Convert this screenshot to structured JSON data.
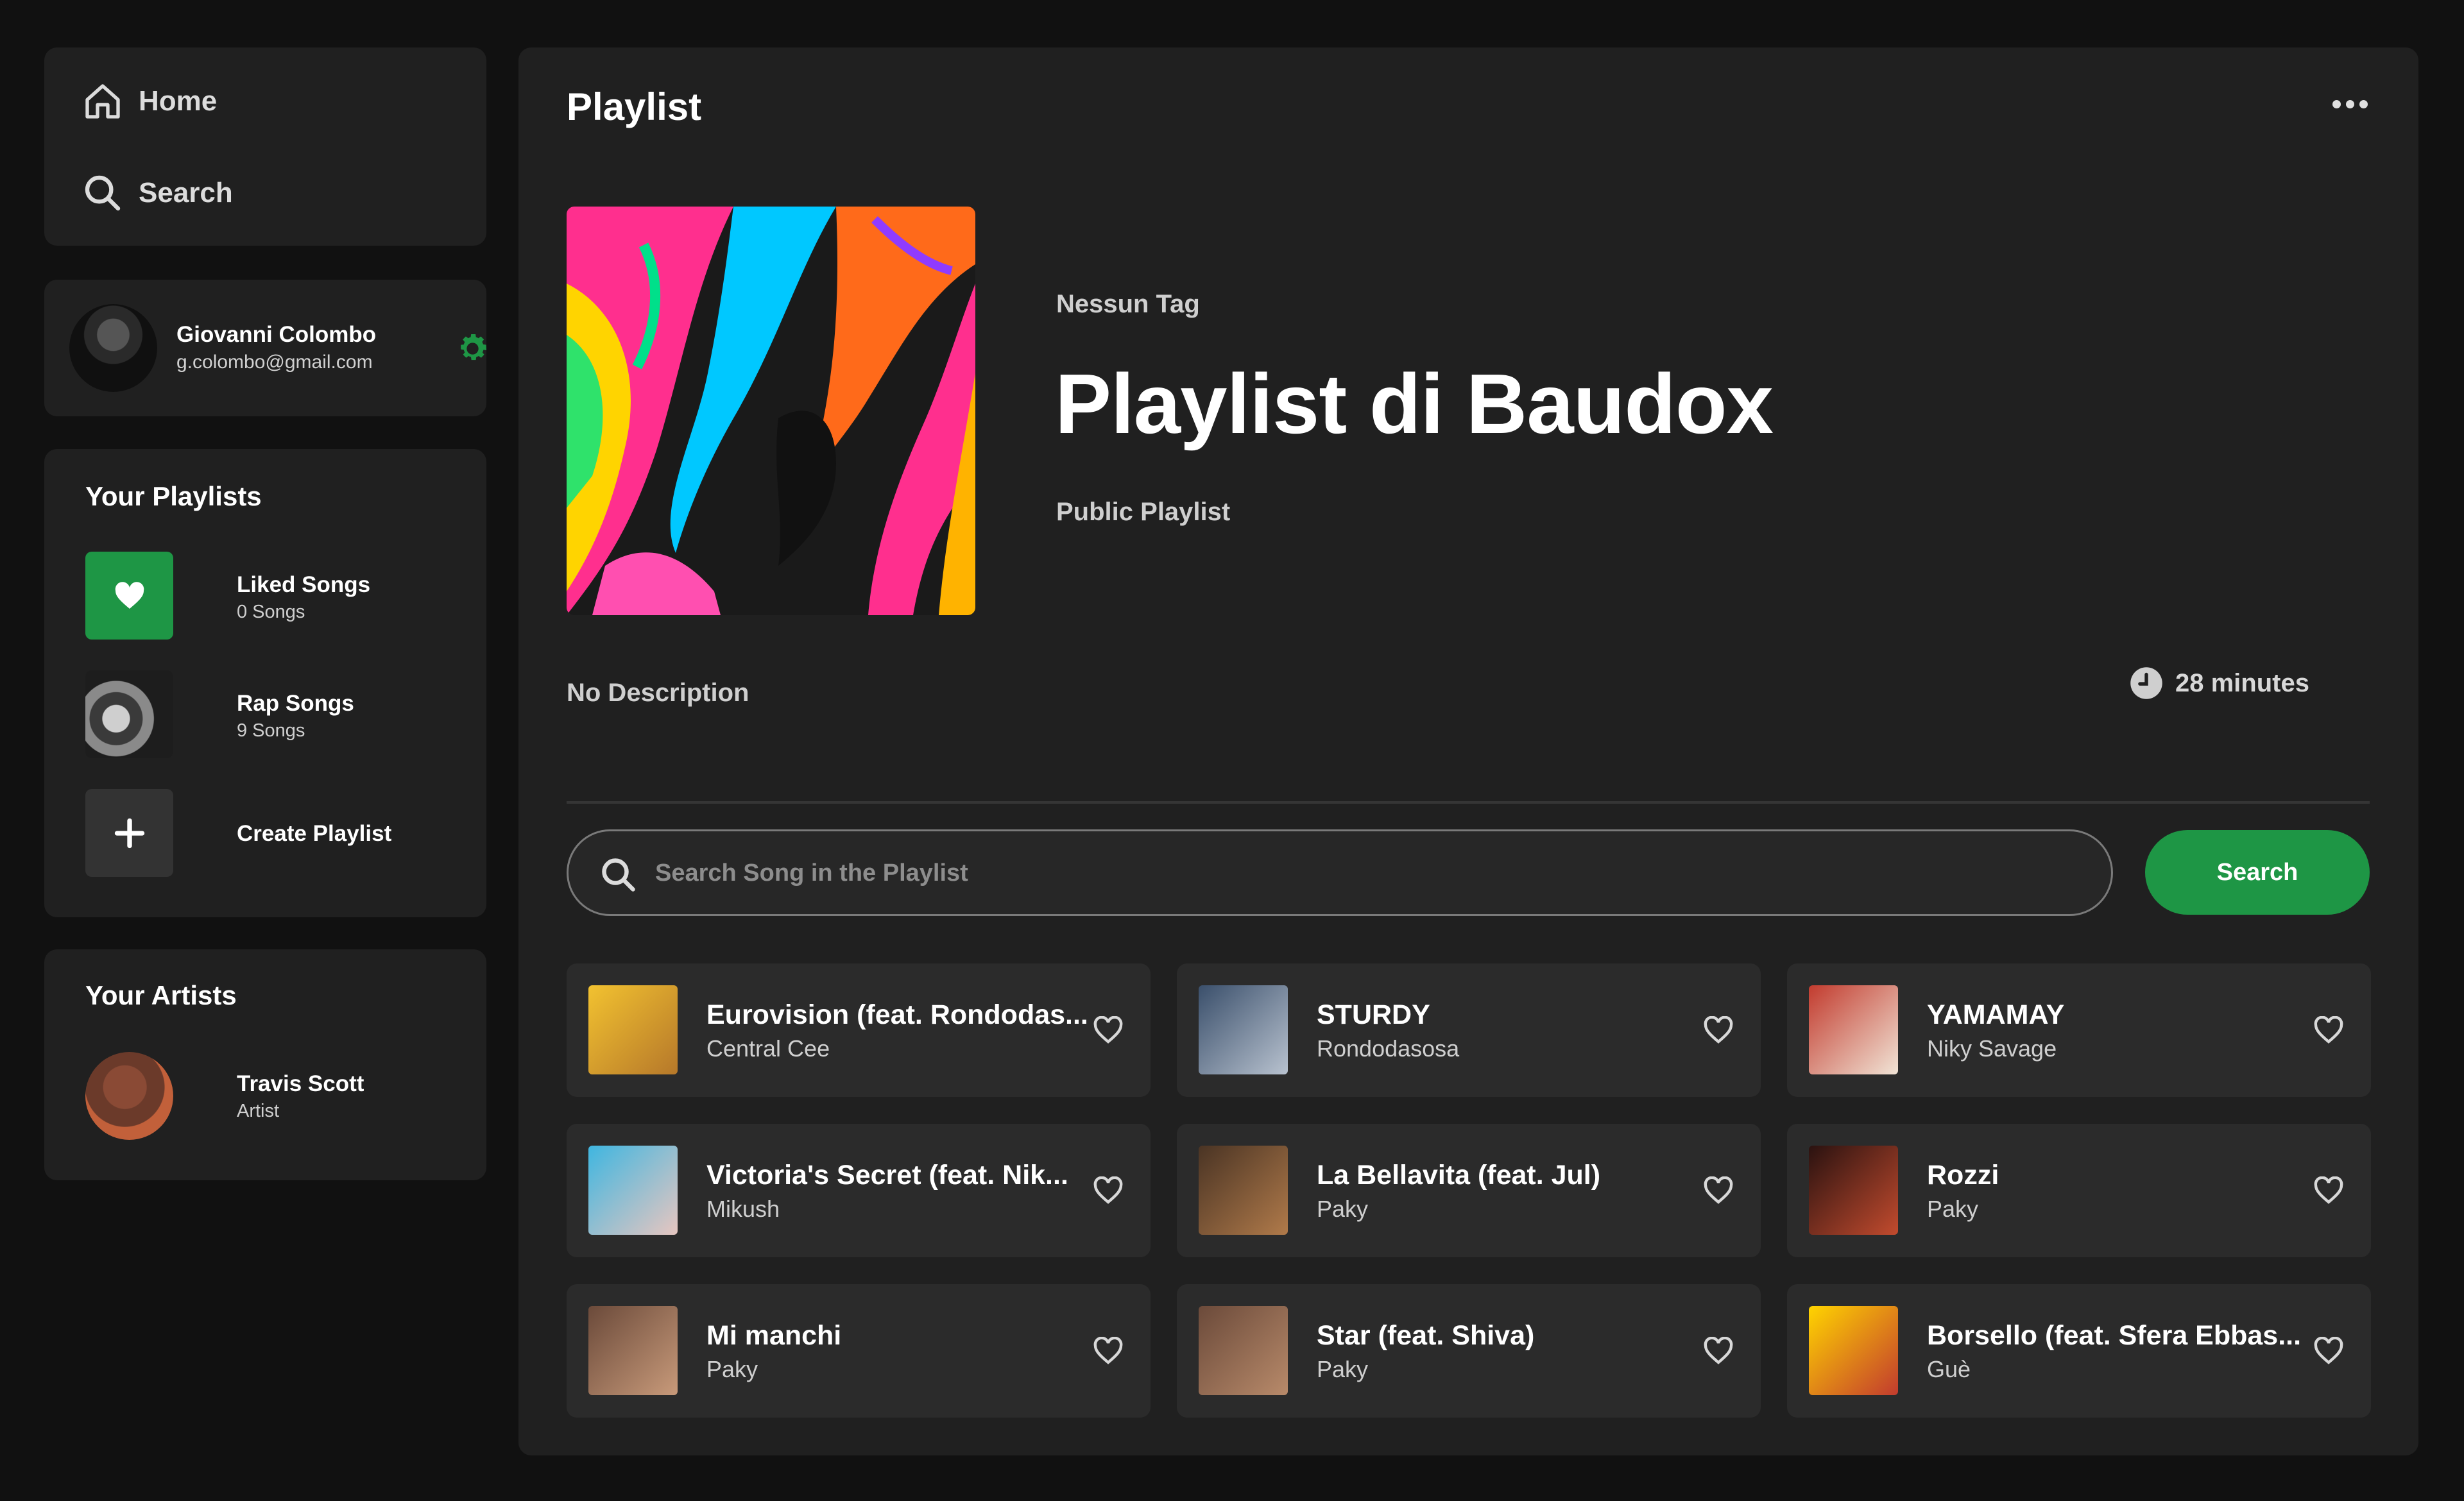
{
  "nav": {
    "home_label": "Home",
    "search_label": "Search"
  },
  "profile": {
    "name": "Giovanni Colombo",
    "email": "g.colombo@gmail.com"
  },
  "playlists": {
    "title": "Your Playlists",
    "items": [
      {
        "name": "Liked Songs",
        "count": "0 Songs"
      },
      {
        "name": "Rap Songs",
        "count": "9 Songs"
      }
    ],
    "create_label": "Create Playlist"
  },
  "artists": {
    "title": "Your Artists",
    "items": [
      {
        "name": "Travis Scott",
        "role": "Artist"
      }
    ]
  },
  "main": {
    "header_title": "Playlist",
    "tag": "Nessun Tag",
    "playlist_title": "Playlist di Baudox",
    "visibility": "Public Playlist",
    "description": "No Description",
    "duration": "28 minutes",
    "search_placeholder": "Search Song in the Playlist",
    "search_button": "Search"
  },
  "songs": [
    {
      "title": "Eurovision (feat. Rondodas...",
      "artist": "Central Cee"
    },
    {
      "title": "STURDY",
      "artist": "Rondodasosa"
    },
    {
      "title": "YAMAMAY",
      "artist": "Niky Savage"
    },
    {
      "title": "Victoria's Secret (feat. Nik...",
      "artist": "Mikush"
    },
    {
      "title": "La Bellavita (feat. Jul)",
      "artist": "Paky"
    },
    {
      "title": "Rozzi",
      "artist": "Paky"
    },
    {
      "title": "Mi manchi",
      "artist": "Paky"
    },
    {
      "title": "Star (feat. Shiva)",
      "artist": "Paky"
    },
    {
      "title": "Borsello (feat. Sfera Ebbas...",
      "artist": "Guè"
    }
  ],
  "colors": {
    "accent_green": "#1e9645",
    "background": "#111111",
    "panel": "#202020",
    "card": "#2b2b2b"
  }
}
